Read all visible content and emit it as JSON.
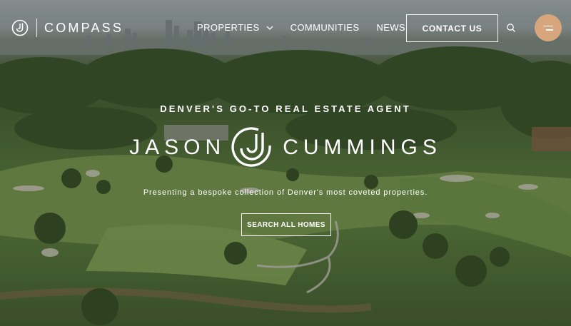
{
  "brand": {
    "name": "COMPASS",
    "icon": "compass-logo-icon"
  },
  "nav": {
    "items": [
      {
        "label": "PROPERTIES",
        "has_dropdown": true
      },
      {
        "label": "COMMUNITIES",
        "has_dropdown": false
      },
      {
        "label": "NEWS",
        "has_dropdown": false
      }
    ],
    "contact_label": "CONTACT US",
    "search_icon": "search-icon",
    "menu_icon": "hamburger-menu-icon"
  },
  "hero": {
    "eyebrow": "DENVER'S GO-TO REAL ESTATE AGENT",
    "agent_first": "JASON",
    "agent_last": "CUMMINGS",
    "agent_logo_icon": "jc-monogram-icon",
    "tagline": "Presenting a bespoke collection of Denver's most coveted properties.",
    "cta_label": "SEARCH ALL HOMES"
  },
  "colors": {
    "menu_button": "#d8a67c",
    "text": "#ffffff"
  }
}
